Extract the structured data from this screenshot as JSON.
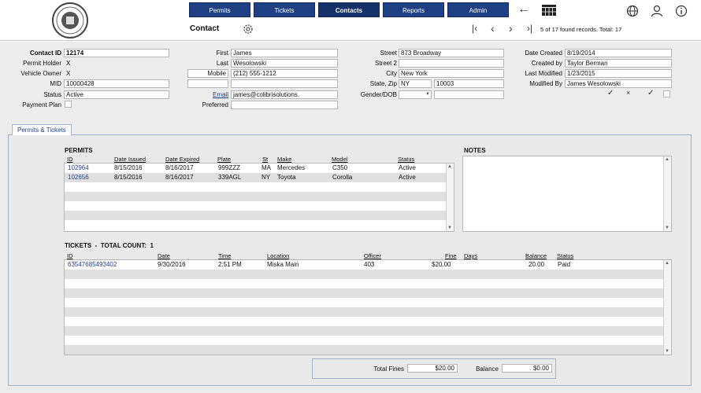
{
  "nav": {
    "buttons": [
      "Permits",
      "Tickets",
      "Contacts",
      "Reports",
      "Admin"
    ]
  },
  "toolbar": {
    "title": "Contact",
    "record_info": "5 of 17 found records. Total: 17"
  },
  "contact": {
    "contact_id_label": "Contact ID",
    "contact_id": "12174",
    "permit_holder_label": "Permit Holder",
    "permit_holder": "X",
    "vehicle_owner_label": "Vehicle Owner",
    "vehicle_owner": "X",
    "mid_label": "MID",
    "mid": "10000428",
    "status_label": "Status",
    "status": "Active",
    "payment_plan_label": "Payment Plan",
    "first_label": "First",
    "first": "James",
    "last_label": "Last",
    "last": "Wesolowski",
    "mobile_label": "Mobile",
    "mobile": "(212) 555-1212",
    "email_label": "Email",
    "email": "james@colibrisolutions.",
    "preferred_label": "Preferred",
    "street_label": "Street",
    "street": "873 Broadway",
    "street2_label": "Street 2",
    "city_label": "City",
    "city": "New York",
    "state_zip_label": "State, Zip",
    "state": "NY",
    "zip": "10003",
    "gender_dob_label": "Gender/DOB",
    "date_created_label": "Date Created",
    "date_created": "8/19/2014",
    "created_by_label": "Created by",
    "created_by": "Taylor Berman",
    "last_modified_label": "Last Modified",
    "last_modified": "1/23/2015",
    "modified_by_label": "Modified By",
    "modified_by": "James Wesolowski"
  },
  "tab": {
    "label": "Permits & Tickets"
  },
  "permits": {
    "title": "PERMITS",
    "columns": [
      "ID",
      "Date Issued",
      "Date Expired",
      "Plate",
      "St",
      "Make",
      "Model",
      "Status"
    ],
    "rows": [
      [
        "102964",
        "8/15/2016",
        "8/16/2017",
        "999ZZZ",
        "MA",
        "Mercedes",
        "C350",
        "Active"
      ],
      [
        "102656",
        "8/15/2016",
        "8/16/2017",
        "339AGL",
        "NY",
        "Toyota",
        "Corolla",
        "Active"
      ]
    ]
  },
  "notes": {
    "title": "NOTES"
  },
  "tickets": {
    "title": "TICKETS  -  TOTAL COUNT:  1",
    "columns": [
      "ID",
      "Date",
      "Time",
      "Location",
      "Officer",
      "Fine",
      "Days",
      "Balance",
      "Status"
    ],
    "rows": [
      [
        "63547685493402",
        "9/30/2016",
        "2:51 PM",
        "Miska Main",
        "403",
        "$20.00",
        "",
        "20.00",
        "Paid"
      ]
    ]
  },
  "totals": {
    "total_fines_label": "Total Fines",
    "total_fines": "$20.00",
    "balance_label": "Balance",
    "balance": "$0.00"
  },
  "colors": {
    "nav_blue": "#1f3f84",
    "link_blue": "#1f3f84"
  },
  "icons": [
    "gear-icon",
    "back-arrow-icon",
    "grid-icon",
    "first-record-icon",
    "prev-record-icon",
    "next-record-icon",
    "last-record-icon",
    "globe-icon",
    "user-icon",
    "info-icon"
  ]
}
